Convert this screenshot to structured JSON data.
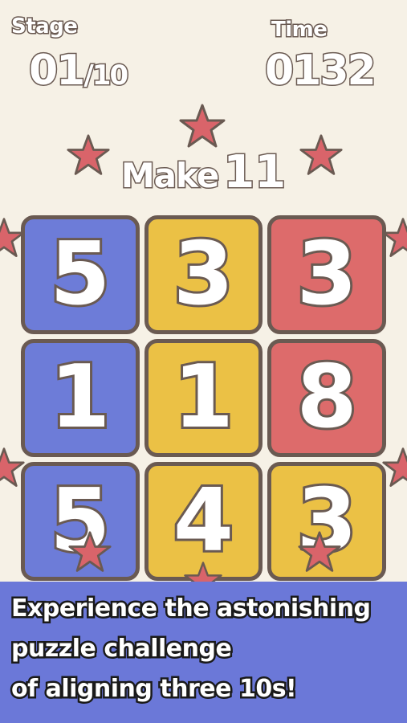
{
  "hud": {
    "stage_label": "Stage",
    "stage_current": "01",
    "stage_total": "/10",
    "time_label": "Time",
    "time_value": "0132"
  },
  "target": {
    "prefix": "Make",
    "number": "11"
  },
  "board": {
    "tiles": [
      {
        "value": "5",
        "color": "#6d7cd8"
      },
      {
        "value": "3",
        "color": "#ebc145"
      },
      {
        "value": "3",
        "color": "#dd6b6b"
      },
      {
        "value": "1",
        "color": "#6d7cd8"
      },
      {
        "value": "1",
        "color": "#ebc145"
      },
      {
        "value": "8",
        "color": "#dd6b6b"
      },
      {
        "value": "5",
        "color": "#6d7cd8"
      },
      {
        "value": "4",
        "color": "#ebc145"
      },
      {
        "value": "3",
        "color": "#ebc145"
      }
    ]
  },
  "banner": {
    "line1": "Experience the astonishing",
    "line2": "puzzle challenge",
    "line3": "of aligning three 10s!"
  },
  "colors": {
    "background": "#f6f1e6",
    "outline": "#6a5a52",
    "star": "#d9646a",
    "banner": "#6b78d8"
  }
}
